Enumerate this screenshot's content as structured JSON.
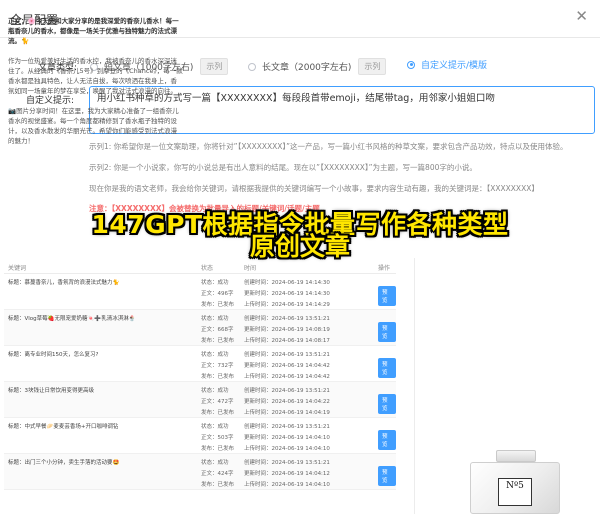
{
  "modal": {
    "title": "全局配置",
    "close": "✕"
  },
  "form": {
    "type_label": "文章类型:",
    "prompt_label": "自定义提示:",
    "radios": [
      {
        "label": "短文章（1000字左右)",
        "example": "示列",
        "selected": false
      },
      {
        "label": "长文章（2000字左右)",
        "example": "示列",
        "selected": false
      },
      {
        "label": "自定义提示/模版",
        "example": "",
        "selected": true
      }
    ],
    "prompt_value": "用小红书种草的方式写一篇【XXXXXXXX】每段段首带emoji，结尾带tag，用邻家小姐姐口吻",
    "hints": [
      "示列1: 你希望你是一位文案助理，你将针对”【XXXXXXXX】”这一产品，写一篇小红书风格的种草文案，要求包含产品功效，特点以及使用体验。",
      "示列2: 你是一个小说家，你写的小说总是有出人意料的结尾。现在以”【XXXXXXXX】”为主题，写一篇800字的小说。",
      "现在你是我的语文老师，我会给你关键词，请根据我提供的关键词编写一个小故事，要求内容生动有趣，我的关键词是：【XXXXXXXX】",
      "注意：【XXXXXXXX】会被替换为批量导入的标题/关键词/话题/主题"
    ]
  },
  "headline": {
    "line1": "147GPT根据指令批量写作各种类型",
    "line2": "原创文章"
  },
  "table": {
    "headers": [
      "关键词",
      "状态",
      "时间",
      "操作"
    ],
    "rows": [
      {
        "title": "标题：慕蔓香奈儿，香氛背的浪漫法式魅力🐈",
        "status": "状态：成功",
        "words": "正文：496字",
        "upload": "发布：已发布",
        "created": "创建时间：2024-06-19 14:14:30",
        "modified": "更新时间：2024-06-19 14:14:30",
        "uploaded": "上传时间：2024-06-19 14:14:29",
        "btn": "预览"
      },
      {
        "title": "标题：Vlog草莓🍓无限宠爱奶糖🍬➕乳清冰淇淋🍨",
        "status": "状态：成功",
        "words": "正文：668字",
        "upload": "发布：已发布",
        "created": "创建时间：2024-06-19 13:51:21",
        "modified": "更新时间：2024-06-19 14:08:19",
        "uploaded": "上传时间：2024-06-19 14:08:17",
        "btn": "预览"
      },
      {
        "title": "标题：离专业时间150天，怎么复习?",
        "status": "状态：成功",
        "words": "正文：732字",
        "upload": "发布：已发布",
        "created": "创建时间：2024-06-19 13:51:21",
        "modified": "更新时间：2024-06-19 14:04:42",
        "uploaded": "上传时间：2024-06-19 14:04:42",
        "btn": "预览"
      },
      {
        "title": "标题：3块钱让日常饮用变得更高级",
        "status": "状态：成功",
        "words": "正文：472字",
        "upload": "发布：已发布",
        "created": "创建时间：2024-06-19 13:51:21",
        "modified": "更新时间：2024-06-19 14:04:22",
        "uploaded": "上传时间：2024-06-19 14:04:19",
        "btn": "预览"
      },
      {
        "title": "标题：中式早餐🥟麦麦芸香场+开口咖啡调钻",
        "status": "状态：成功",
        "words": "正文：503字",
        "upload": "发布：已发布",
        "created": "创建时间：2024-06-19 13:51:21",
        "modified": "更新时间：2024-06-19 14:04:10",
        "uploaded": "上传时间：2024-06-19 14:04:10",
        "btn": "预览"
      },
      {
        "title": "标题：出门三个小分钟，卖生手落的活动要🤩",
        "status": "状态：成功",
        "words": "正文：424字",
        "upload": "发布：已发布",
        "created": "创建时间：2024-06-19 13:51:21",
        "modified": "更新时间：2024-06-19 14:04:12",
        "uploaded": "上传时间：2024-06-19 14:04:10",
        "btn": "预览"
      }
    ]
  },
  "preview": {
    "p1": "正文：🌸今天要和大家分享的是我深爱的香奈儿香水！每一瓶香奈儿的香水，都像是一场关于优雅与独特魅力的法式漂流。🐈",
    "p2": "作为一位热爱美好生活的香水控，我被香奈儿的香水深深迷住了。从经典的《香奈儿5号》到摩登的《Chance》，每一款香水都是独具特色，让人无法自拔，每次喷洒在我身上，香氛如同一场童年的梦在享受，唤醒了我对法式浪漫的向往。",
    "p3": "📷图片分享时间！在这里，我为大家精心准备了一组香奈儿香水的视觉盛宴。每一个角度都精修到了香水瓶子独特的设计，以及香水散发的华丽光芒。希望你们能感受到法式浪漫的魅力！",
    "bottle_label": "Nº5"
  }
}
